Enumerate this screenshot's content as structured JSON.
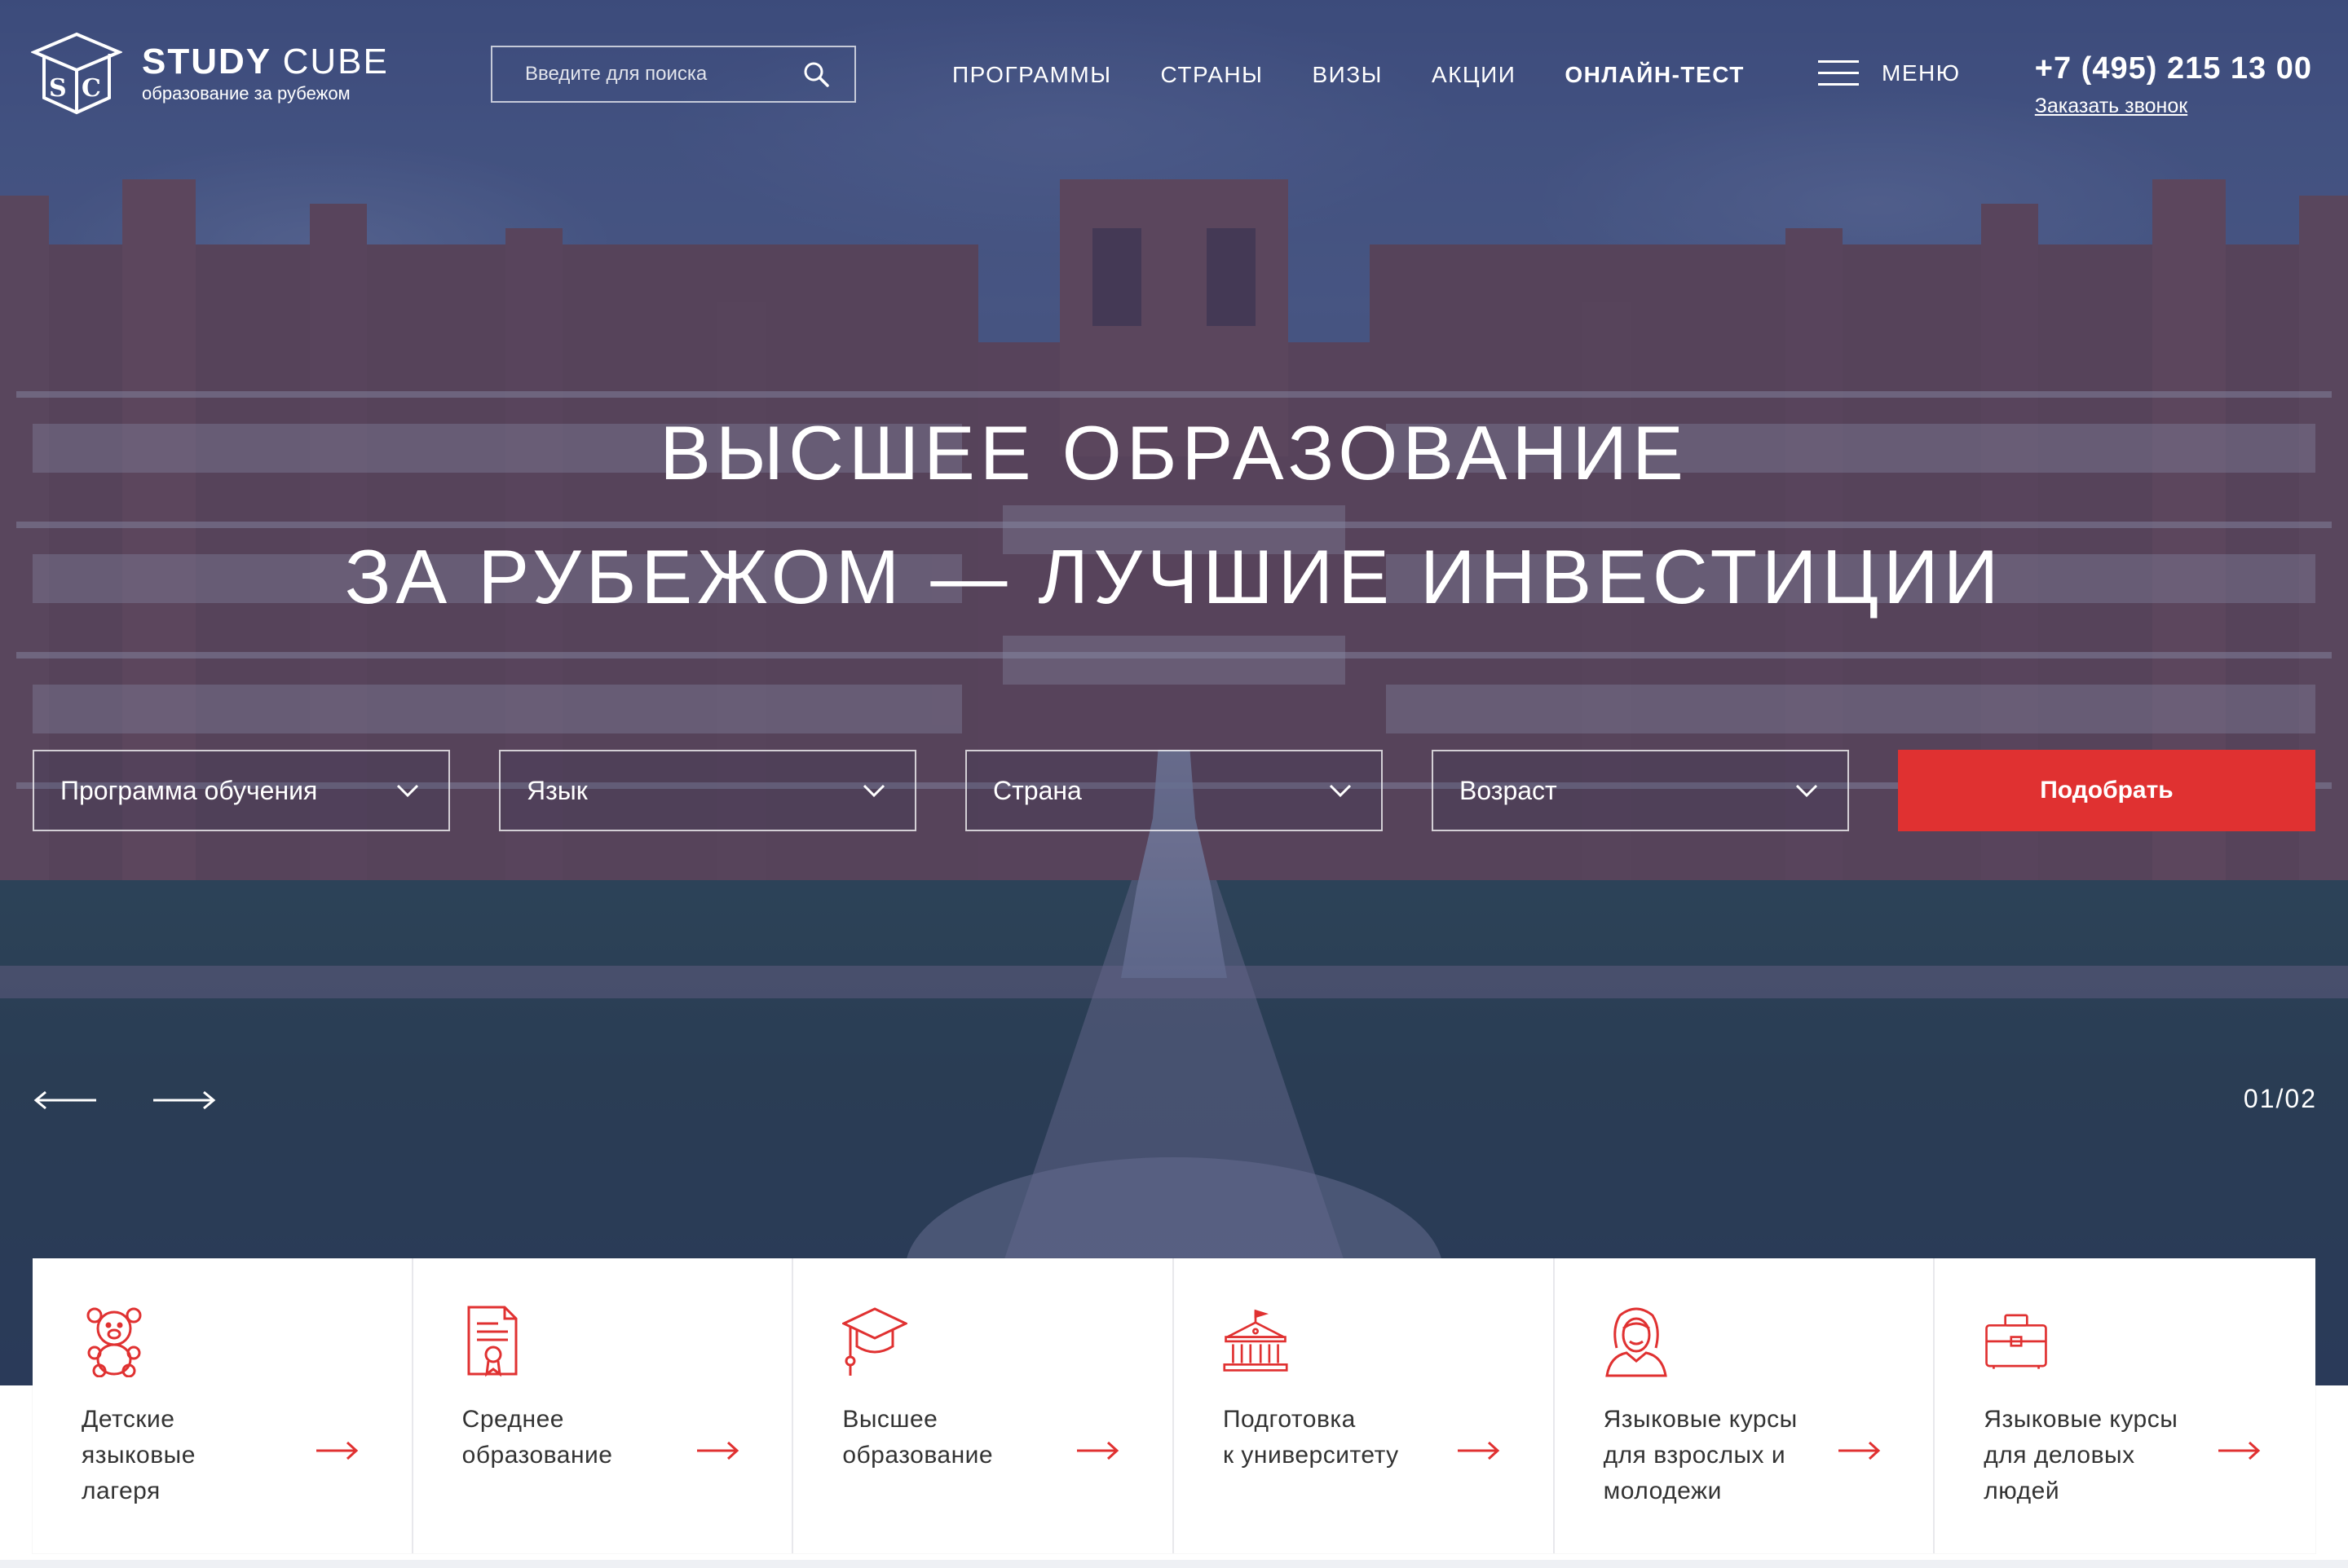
{
  "brand": {
    "name_bold": "STUDY",
    "name_light": "CUBE",
    "tagline": "образование за рубежом",
    "logo_letters": "SC"
  },
  "search": {
    "placeholder": "Введите для поиска",
    "icon": "search-icon"
  },
  "nav": {
    "items": [
      {
        "label": "ПРОГРАММЫ"
      },
      {
        "label": "СТРАНЫ"
      },
      {
        "label": "ВИЗЫ"
      },
      {
        "label": "АКЦИИ"
      },
      {
        "label": "ОНЛАЙН-ТЕСТ"
      }
    ],
    "menu_label": "МЕНЮ"
  },
  "contact": {
    "phone": "+7 (495) 215 13 00",
    "callback": "Заказать звонок"
  },
  "hero": {
    "title_line1": "ВЫСШЕЕ ОБРАЗОВАНИЕ",
    "title_line2": "ЗА РУБЕЖОМ — ЛУЧШИЕ ИНВЕСТИЦИИ"
  },
  "filters": {
    "program": "Программа обучения",
    "language": "Язык",
    "country": "Страна",
    "age": "Возраст",
    "submit": "Подобрать"
  },
  "slider": {
    "counter": "01/02"
  },
  "cards": [
    {
      "icon": "teddy-bear-icon",
      "line1": "Детские",
      "line2": "языковые",
      "line3": "лагеря"
    },
    {
      "icon": "certificate-icon",
      "line1": "Среднее",
      "line2": "образование",
      "line3": ""
    },
    {
      "icon": "graduation-cap-icon",
      "line1": "Высшее",
      "line2": "образование",
      "line3": ""
    },
    {
      "icon": "university-building-icon",
      "line1": "Подготовка",
      "line2": "к университету",
      "line3": ""
    },
    {
      "icon": "woman-avatar-icon",
      "line1": "Языковые курсы",
      "line2": "для взрослых и",
      "line3": "молодежи"
    },
    {
      "icon": "briefcase-icon",
      "line1": "Языковые курсы",
      "line2": "для деловых",
      "line3": "людей"
    }
  ],
  "colors": {
    "accent_red": "#e03131",
    "overlay_blue": "#2a3a6e",
    "card_text": "#333333"
  }
}
